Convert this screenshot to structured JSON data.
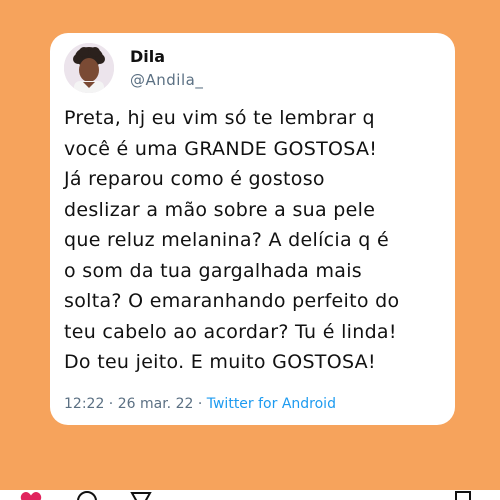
{
  "tweet": {
    "author_name": "Dila",
    "author_handle": "@Andila_",
    "lines": [
      "Preta, hj eu vim só te lembrar q",
      "você é uma GRANDE GOSTOSA!",
      "Já reparou como é gostoso",
      "deslizar a mão sobre a sua pele",
      "que reluz melanina? A delícia q é",
      "o som da tua gargalhada mais",
      "solta? O emaranhando perfeito do",
      "teu cabelo ao acordar? Tu é linda!",
      "Do teu jeito. E muito GOSTOSA!"
    ],
    "time": "12:22",
    "separator_1": " · ",
    "date": "26 mar. 22",
    "separator_2": " · ",
    "source": "Twitter for Android"
  },
  "colors": {
    "background": "#f6a35c",
    "card": "#ffffff",
    "link": "#1d9bf0",
    "muted": "#5b7083",
    "like": "#e0245e"
  },
  "action_bar": {
    "icons": [
      "heart-icon",
      "comment-icon",
      "share-icon",
      "bookmark-icon"
    ]
  }
}
